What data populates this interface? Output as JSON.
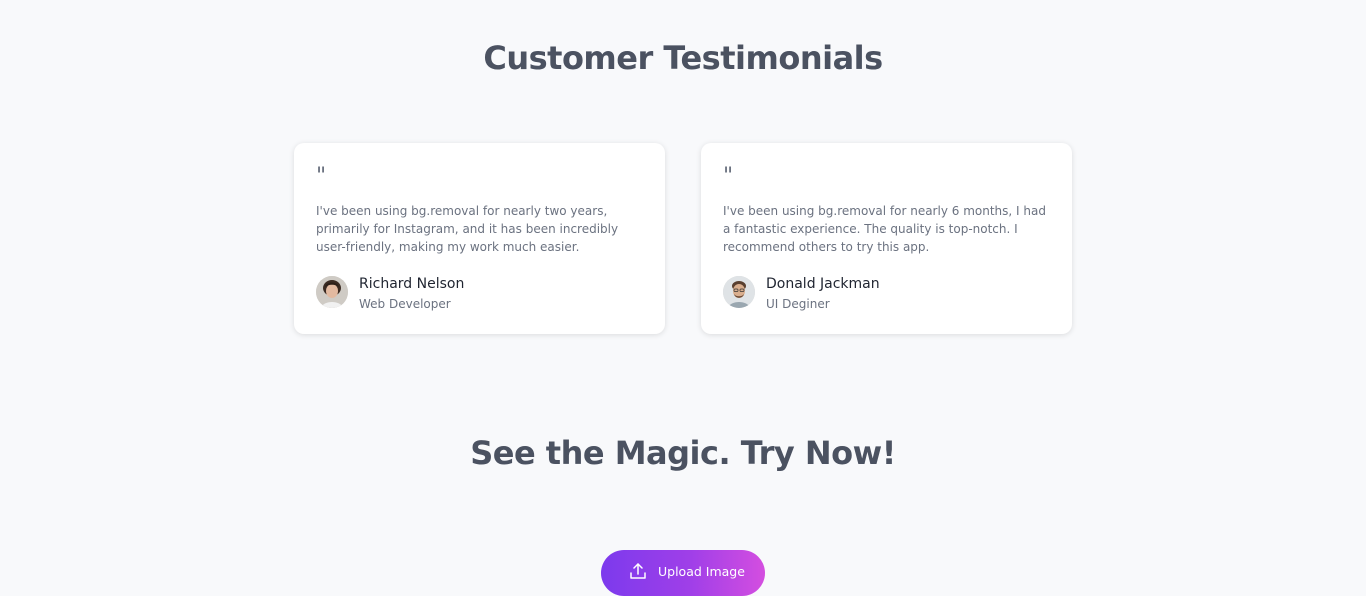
{
  "testimonials": {
    "title": "Customer Testimonials",
    "items": [
      {
        "quote_mark": "\"",
        "text": "I've been using bg.removal for nearly two years, primarily for Instagram, and it has been incredibly user-friendly, making my work much easier.",
        "name": "Richard Nelson",
        "role": "Web Developer",
        "avatar_icon": "avatar-photo"
      },
      {
        "quote_mark": "\"",
        "text": "I've been using bg.removal for nearly 6 months, I had a fantastic experience. The quality is top-notch. I recommend others to try this app.",
        "name": "Donald Jackman",
        "role": "UI Deginer",
        "avatar_icon": "avatar-photo"
      }
    ]
  },
  "cta": {
    "title": "See the Magic. Try Now!",
    "upload_label": "Upload Image",
    "upload_icon": "upload-icon"
  },
  "colors": {
    "background": "#f8f9fb",
    "heading": "#4b5261",
    "button_gradient_start": "#7c3aed",
    "button_gradient_end": "#d44ee0"
  }
}
